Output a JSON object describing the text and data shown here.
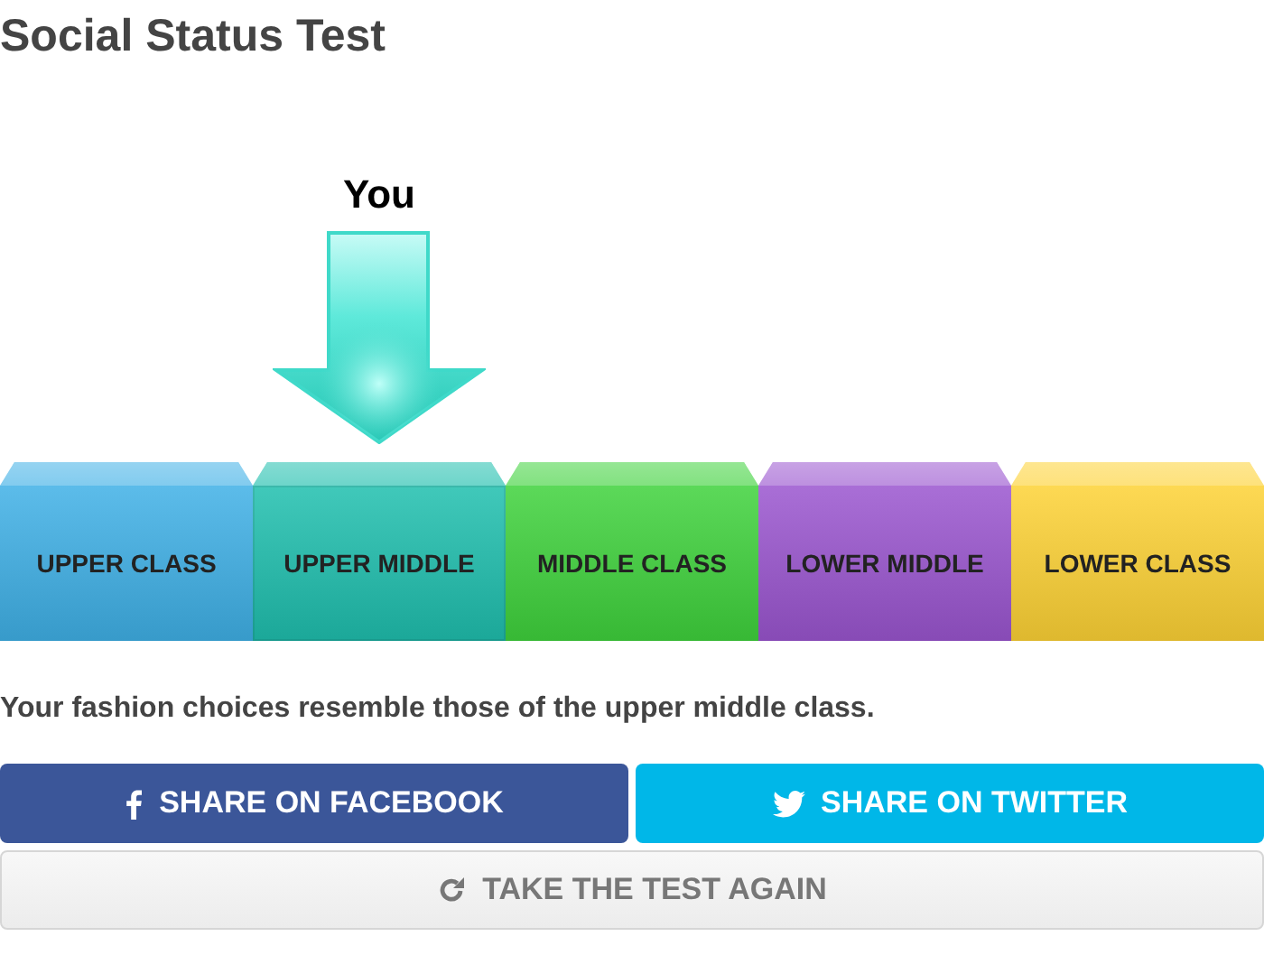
{
  "title": "Social Status Test",
  "marker_label": "You",
  "classes": [
    {
      "label": "UPPER CLASS",
      "color": "#3fb0e6",
      "selected": false
    },
    {
      "label": "UPPER MIDDLE",
      "color": "#1fbfae",
      "selected": true
    },
    {
      "label": "MIDDLE CLASS",
      "color": "#3fd23c",
      "selected": false
    },
    {
      "label": "LOWER MIDDLE",
      "color": "#9a55cf",
      "selected": false
    },
    {
      "label": "LOWER CLASS",
      "color": "#fdd235",
      "selected": false
    }
  ],
  "result": "Your fashion choices resemble those of the upper middle class.",
  "buttons": [
    {
      "kind": "facebook",
      "label": "SHARE ON FACEBOOK"
    },
    {
      "kind": "twitter",
      "label": "SHARE ON TWITTER"
    },
    {
      "kind": "retry",
      "label": "TAKE THE TEST AGAIN"
    }
  ]
}
